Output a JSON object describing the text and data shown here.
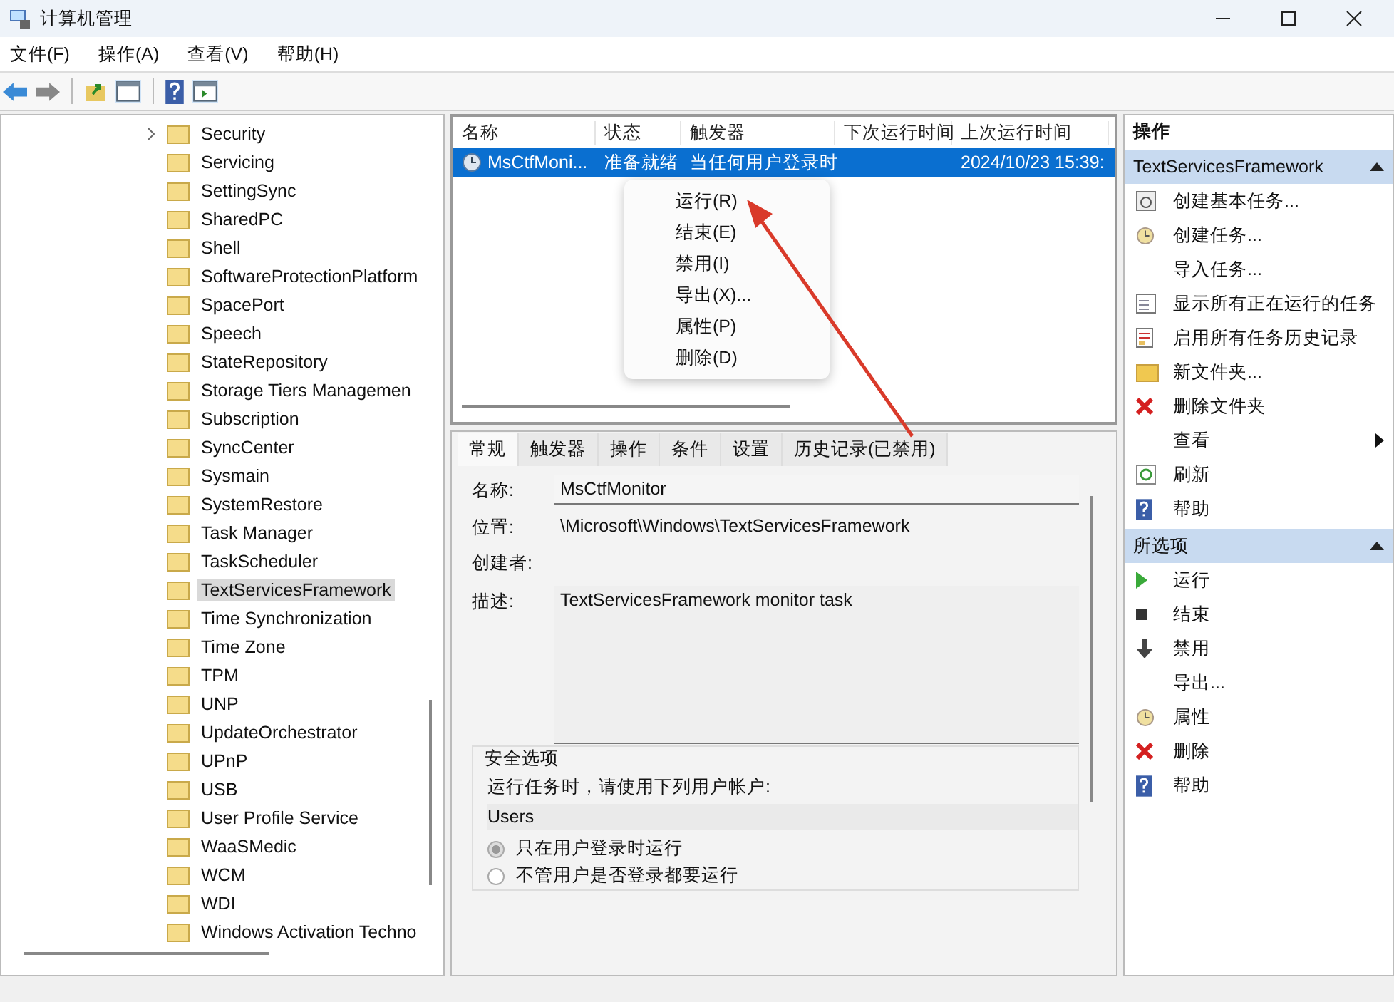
{
  "window": {
    "title": "计算机管理"
  },
  "menu": [
    "文件(F)",
    "操作(A)",
    "查看(V)",
    "帮助(H)"
  ],
  "tree": {
    "items": [
      {
        "label": "Security",
        "selected": false,
        "expandable": true
      },
      {
        "label": "Servicing",
        "selected": false
      },
      {
        "label": "SettingSync",
        "selected": false
      },
      {
        "label": "SharedPC",
        "selected": false
      },
      {
        "label": "Shell",
        "selected": false
      },
      {
        "label": "SoftwareProtectionPlatform",
        "selected": false
      },
      {
        "label": "SpacePort",
        "selected": false
      },
      {
        "label": "Speech",
        "selected": false
      },
      {
        "label": "StateRepository",
        "selected": false
      },
      {
        "label": "Storage Tiers Managemen",
        "selected": false
      },
      {
        "label": "Subscription",
        "selected": false
      },
      {
        "label": "SyncCenter",
        "selected": false
      },
      {
        "label": "Sysmain",
        "selected": false
      },
      {
        "label": "SystemRestore",
        "selected": false
      },
      {
        "label": "Task Manager",
        "selected": false
      },
      {
        "label": "TaskScheduler",
        "selected": false
      },
      {
        "label": "TextServicesFramework",
        "selected": true
      },
      {
        "label": "Time Synchronization",
        "selected": false
      },
      {
        "label": "Time Zone",
        "selected": false
      },
      {
        "label": "TPM",
        "selected": false
      },
      {
        "label": "UNP",
        "selected": false
      },
      {
        "label": "UpdateOrchestrator",
        "selected": false
      },
      {
        "label": "UPnP",
        "selected": false
      },
      {
        "label": "USB",
        "selected": false
      },
      {
        "label": "User Profile Service",
        "selected": false
      },
      {
        "label": "WaaSMedic",
        "selected": false
      },
      {
        "label": "WCM",
        "selected": false
      },
      {
        "label": "WDI",
        "selected": false
      },
      {
        "label": "Windows Activation Techno",
        "selected": false
      }
    ]
  },
  "table": {
    "columns": [
      "名称",
      "状态",
      "触发器",
      "下次运行时间",
      "上次运行时间"
    ],
    "rows": [
      {
        "name": "MsCtfMoni...",
        "status": "准备就绪",
        "trigger": "当任何用户登录时",
        "last_run": "2024/10/23 15:39:",
        "selected": true
      }
    ]
  },
  "context_menu": [
    "运行(R)",
    "结束(E)",
    "禁用(I)",
    "导出(X)...",
    "属性(P)",
    "删除(D)"
  ],
  "details": {
    "tabs": [
      {
        "label": "常规",
        "selected": true
      },
      {
        "label": "触发器",
        "selected": false
      },
      {
        "label": "操作",
        "selected": false
      },
      {
        "label": "条件",
        "selected": false
      },
      {
        "label": "设置",
        "selected": false
      },
      {
        "label": "历史记录(已禁用)",
        "selected": false
      }
    ],
    "fields": [
      {
        "label": "名称:",
        "value": "MsCtfMonitor",
        "kind": "input"
      },
      {
        "label": "位置:",
        "value": "\\Microsoft\\Windows\\TextServicesFramework",
        "kind": "text"
      },
      {
        "label": "创建者:",
        "kind": "text"
      },
      {
        "label": "描述:",
        "value": "TextServicesFramework monitor task",
        "kind": "textarea"
      }
    ],
    "security": {
      "legend": "安全选项",
      "prompt": "运行任务时，请使用下列用户帐户:",
      "account": "Users",
      "options": [
        {
          "label": "只在用户登录时运行",
          "selected": true
        },
        {
          "label": "不管用户是否登录都要运行",
          "selected": false
        }
      ]
    }
  },
  "actions": {
    "title": "操作",
    "sections": [
      {
        "title": "TextServicesFramework",
        "expanded": true,
        "items": [
          {
            "label": "创建基本任务..."
          },
          {
            "label": "创建任务..."
          },
          {
            "label": "导入任务..."
          },
          {
            "label": "显示所有正在运行的任务"
          },
          {
            "label": "启用所有任务历史记录"
          },
          {
            "label": "新文件夹..."
          },
          {
            "label": "删除文件夹"
          },
          {
            "label": "查看",
            "submenu": true
          },
          {
            "label": "刷新"
          },
          {
            "label": "帮助"
          }
        ]
      },
      {
        "title": "所选项",
        "expanded": true,
        "items": [
          {
            "label": "运行"
          },
          {
            "label": "结束"
          },
          {
            "label": "禁用"
          },
          {
            "label": "导出..."
          },
          {
            "label": "属性"
          },
          {
            "label": "删除"
          },
          {
            "label": "帮助"
          }
        ]
      }
    ]
  }
}
